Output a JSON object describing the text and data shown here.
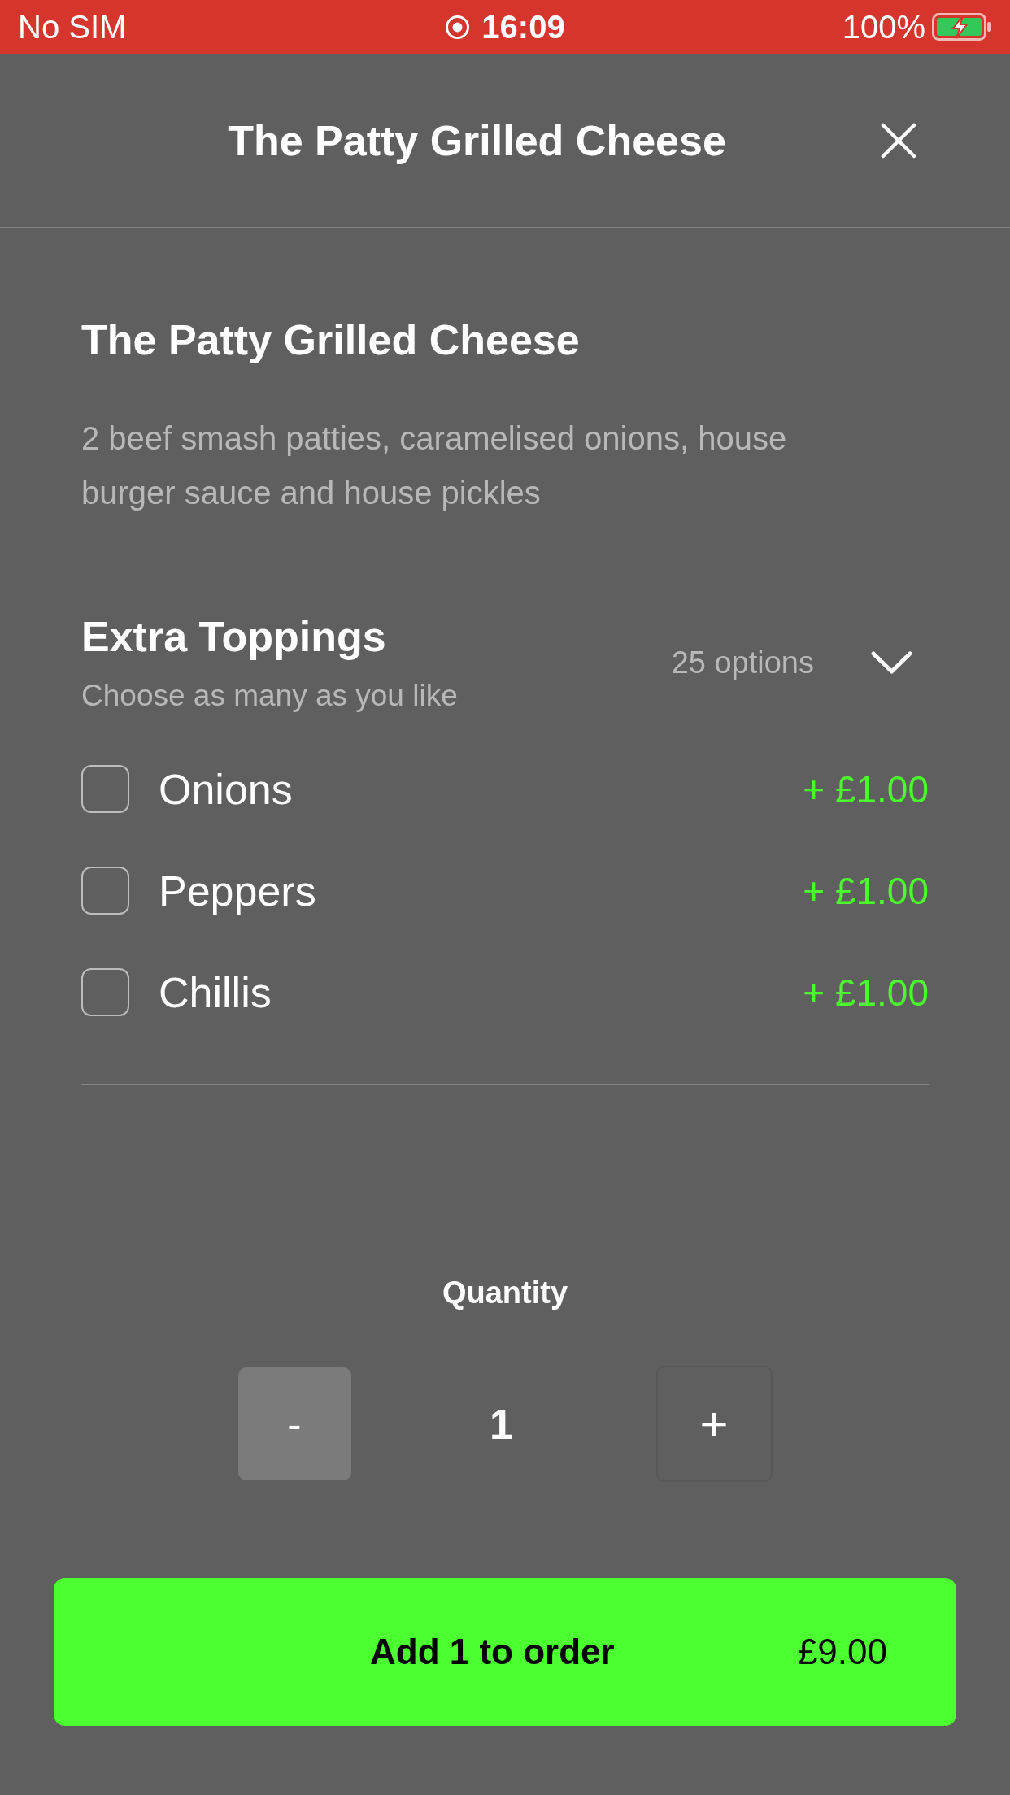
{
  "status_bar": {
    "carrier": "No SIM",
    "time": "16:09",
    "battery": "100%"
  },
  "header": {
    "title": "The Patty Grilled Cheese"
  },
  "item": {
    "name": "The Patty Grilled Cheese",
    "description": "2 beef smash patties, caramelised onions, house burger sauce and house pickles"
  },
  "option_group": {
    "title": "Extra Toppings",
    "hint": "Choose as many as you like",
    "count": "25 options",
    "options": [
      {
        "label": "Onions",
        "price": "+ £1.00",
        "checked": false
      },
      {
        "label": "Peppers",
        "price": "+ £1.00",
        "checked": false
      },
      {
        "label": "Chillis",
        "price": "+ £1.00",
        "checked": false
      }
    ]
  },
  "quantity": {
    "label": "Quantity",
    "decrement": "-",
    "value": "1",
    "increment": "+"
  },
  "add_button": {
    "label": "Add 1 to order",
    "price": "£9.00"
  }
}
